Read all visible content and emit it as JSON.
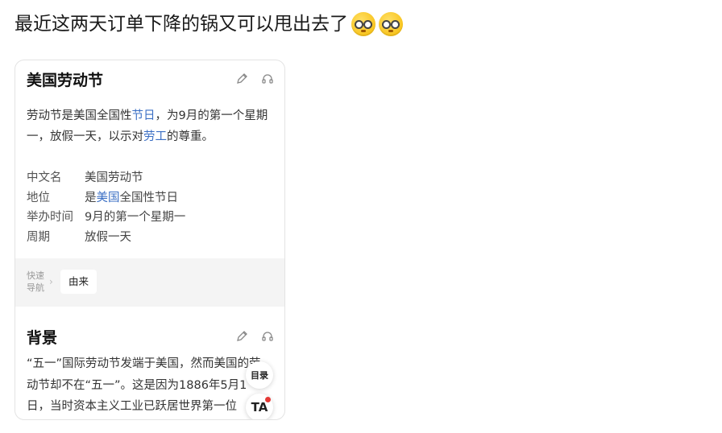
{
  "post": {
    "text": "最近这两天订单下降的锅又可以甩出去了",
    "emojis": [
      "nerd-face-emoji",
      "nerd-face-emoji"
    ]
  },
  "card": {
    "title": "美国劳动节",
    "edit_icon": "pencil-icon",
    "listen_icon": "headphones-icon",
    "intro": {
      "p1": "劳动节是美国全国性",
      "link1": "节日",
      "p2": "，为9月的第一个星期一，放假一天，以示对",
      "link2": "劳工",
      "p3": "的尊重。"
    },
    "info": [
      {
        "key": "中文名",
        "value": "美国劳动节"
      },
      {
        "key": "地位",
        "pre": "是",
        "link": "美国",
        "post": "全国性节日"
      },
      {
        "key": "举办时间",
        "value": "9月的第一个星期一"
      },
      {
        "key": "周期",
        "value": "放假一天"
      }
    ],
    "quick_nav": {
      "label": "快速导航",
      "button": "由来"
    },
    "background": {
      "title": "背景",
      "text": "“五一”国际劳动节发端于美国，然而美国的劳动节却不在“五一”。这是因为1886年5月1日，当时资本主义工业已跃居世界第一位"
    },
    "fab": {
      "toc": "目录",
      "ta": "TA"
    }
  }
}
